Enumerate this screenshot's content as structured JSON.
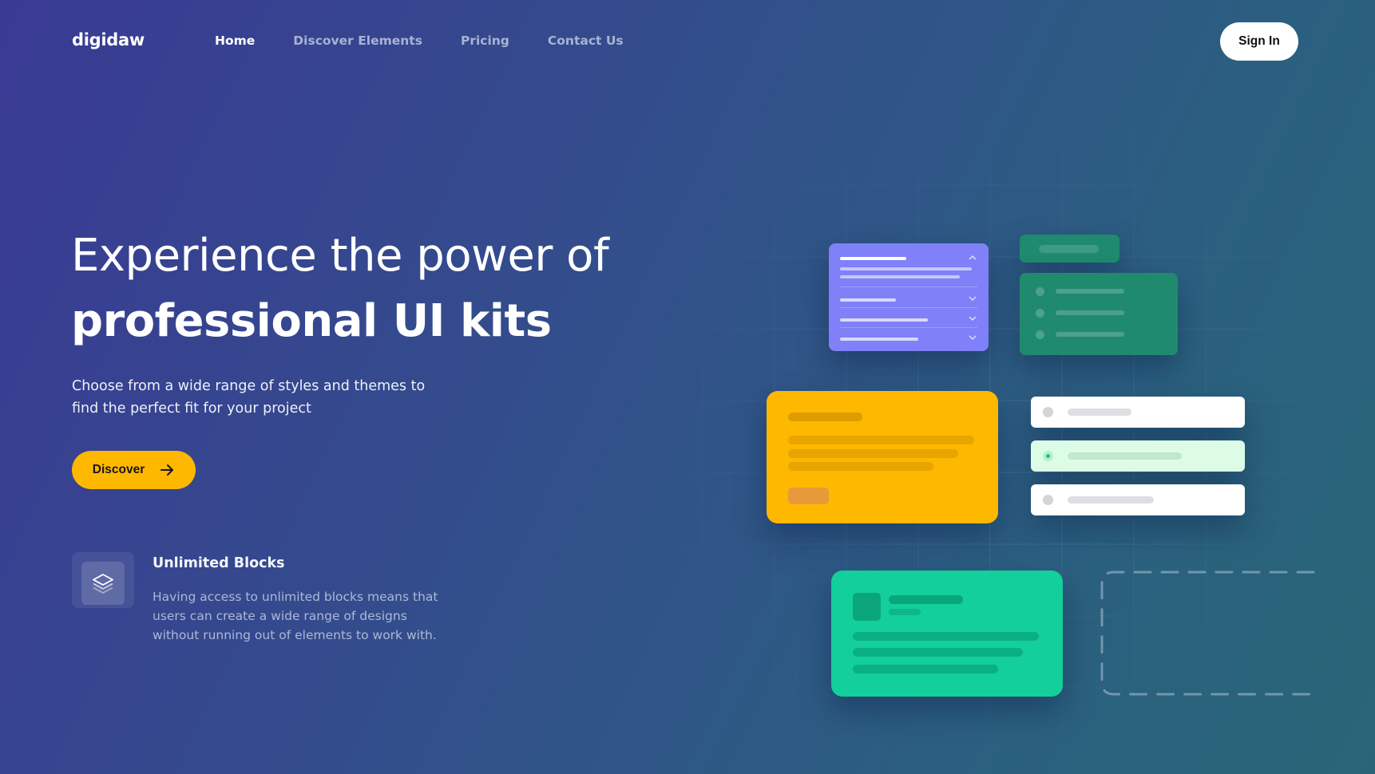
{
  "header": {
    "logo": "digidaw",
    "nav": [
      {
        "label": "Home",
        "active": true
      },
      {
        "label": "Discover Elements",
        "active": false
      },
      {
        "label": "Pricing",
        "active": false
      },
      {
        "label": "Contact Us",
        "active": false
      }
    ],
    "sign_in_label": "Sign In"
  },
  "hero": {
    "title_line1": "Experience the power of",
    "title_line2": "professional UI kits",
    "subtitle": "Choose from a wide range of styles and themes to find the perfect fit for your project",
    "cta_label": "Discover",
    "cta_icon": "arrow-right-icon"
  },
  "feature": {
    "icon": "layers-icon",
    "title": "Unlimited Blocks",
    "description": "Having access to unlimited blocks means that users can create a wide range of designs without running out of elements to work with."
  },
  "colors": {
    "accent": "#ffb800",
    "card_purple": "#8080f8",
    "card_green_dark": "#1f8a6e",
    "card_mint": "#12cf9c",
    "selected_row": "#ddfce6"
  }
}
